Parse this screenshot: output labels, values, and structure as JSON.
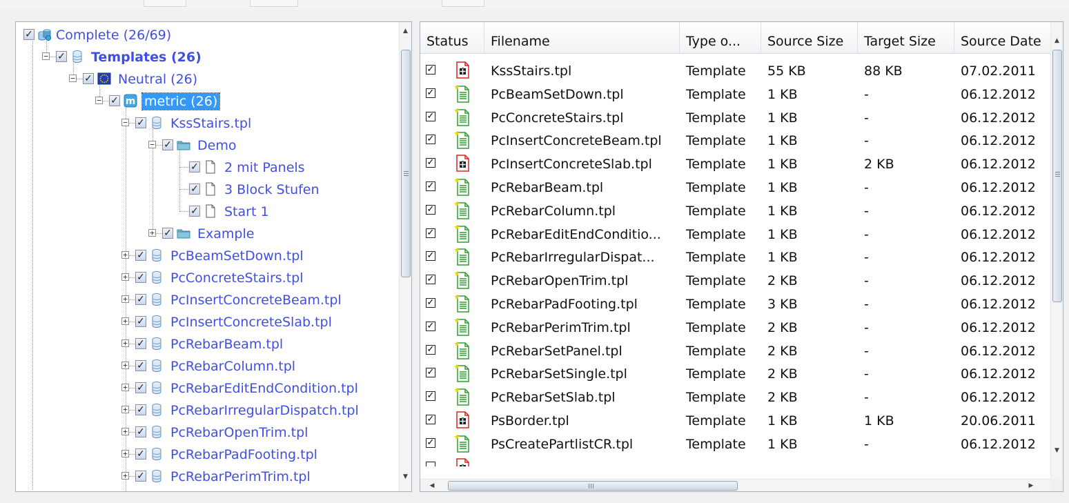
{
  "tree": {
    "items": [
      {
        "label": "Complete (26/69)",
        "level": 0,
        "expander": "none",
        "icon": "database-group-icon",
        "bold": false,
        "selected": false
      },
      {
        "label": "Templates (26)",
        "level": 1,
        "expander": "minus",
        "icon": "database-icon",
        "bold": true,
        "selected": false
      },
      {
        "label": "Neutral (26)",
        "level": 2,
        "expander": "minus",
        "icon": "eu-flag-icon",
        "bold": false,
        "selected": false
      },
      {
        "label": "metric (26)",
        "level": 3,
        "expander": "minus",
        "icon": "metric-m-icon",
        "bold": false,
        "selected": true
      },
      {
        "label": "KssStairs.tpl",
        "level": 4,
        "expander": "minus",
        "icon": "database-icon",
        "bold": false,
        "selected": false
      },
      {
        "label": "Demo",
        "level": 5,
        "expander": "minus",
        "icon": "folder-icon",
        "bold": false,
        "selected": false
      },
      {
        "label": "2 mit Panels",
        "level": 6,
        "expander": "none",
        "icon": "document-icon",
        "bold": false,
        "selected": false
      },
      {
        "label": "3 Block Stufen",
        "level": 6,
        "expander": "none",
        "icon": "document-icon",
        "bold": false,
        "selected": false
      },
      {
        "label": "Start 1",
        "level": 6,
        "expander": "none",
        "icon": "document-icon",
        "bold": false,
        "selected": false
      },
      {
        "label": "Example",
        "level": 5,
        "expander": "plus",
        "icon": "folder-icon",
        "bold": false,
        "selected": false
      },
      {
        "label": "PcBeamSetDown.tpl",
        "level": 4,
        "expander": "plus",
        "icon": "database-icon",
        "bold": false,
        "selected": false
      },
      {
        "label": "PcConcreteStairs.tpl",
        "level": 4,
        "expander": "plus",
        "icon": "database-icon",
        "bold": false,
        "selected": false
      },
      {
        "label": "PcInsertConcreteBeam.tpl",
        "level": 4,
        "expander": "plus",
        "icon": "database-icon",
        "bold": false,
        "selected": false
      },
      {
        "label": "PcInsertConcreteSlab.tpl",
        "level": 4,
        "expander": "plus",
        "icon": "database-icon",
        "bold": false,
        "selected": false
      },
      {
        "label": "PcRebarBeam.tpl",
        "level": 4,
        "expander": "plus",
        "icon": "database-icon",
        "bold": false,
        "selected": false
      },
      {
        "label": "PcRebarColumn.tpl",
        "level": 4,
        "expander": "plus",
        "icon": "database-icon",
        "bold": false,
        "selected": false
      },
      {
        "label": "PcRebarEditEndCondition.tpl",
        "level": 4,
        "expander": "plus",
        "icon": "database-icon",
        "bold": false,
        "selected": false
      },
      {
        "label": "PcRebarIrregularDispatch.tpl",
        "level": 4,
        "expander": "plus",
        "icon": "database-icon",
        "bold": false,
        "selected": false
      },
      {
        "label": "PcRebarOpenTrim.tpl",
        "level": 4,
        "expander": "plus",
        "icon": "database-icon",
        "bold": false,
        "selected": false
      },
      {
        "label": "PcRebarPadFooting.tpl",
        "level": 4,
        "expander": "plus",
        "icon": "database-icon",
        "bold": false,
        "selected": false
      },
      {
        "label": "PcRebarPerimTrim.tpl",
        "level": 4,
        "expander": "plus",
        "icon": "database-icon",
        "bold": false,
        "selected": false
      }
    ]
  },
  "list": {
    "columns": [
      "Status",
      "Filename",
      "Type o...",
      "Source Size",
      "Target Size",
      "Source Date"
    ],
    "rows": [
      {
        "status": "conflict",
        "filename": "KssStairs.tpl",
        "type": "Template",
        "source_size": "55 KB",
        "target_size": "88 KB",
        "source_date": "07.02.2011"
      },
      {
        "status": "new",
        "filename": "PcBeamSetDown.tpl",
        "type": "Template",
        "source_size": "1 KB",
        "target_size": "-",
        "source_date": "06.12.2012"
      },
      {
        "status": "new",
        "filename": "PcConcreteStairs.tpl",
        "type": "Template",
        "source_size": "1 KB",
        "target_size": "-",
        "source_date": "06.12.2012"
      },
      {
        "status": "new",
        "filename": "PcInsertConcreteBeam.tpl",
        "type": "Template",
        "source_size": "1 KB",
        "target_size": "-",
        "source_date": "06.12.2012"
      },
      {
        "status": "conflict",
        "filename": "PcInsertConcreteSlab.tpl",
        "type": "Template",
        "source_size": "1 KB",
        "target_size": "2 KB",
        "source_date": "06.12.2012"
      },
      {
        "status": "new",
        "filename": "PcRebarBeam.tpl",
        "type": "Template",
        "source_size": "1 KB",
        "target_size": "-",
        "source_date": "06.12.2012"
      },
      {
        "status": "new",
        "filename": "PcRebarColumn.tpl",
        "type": "Template",
        "source_size": "1 KB",
        "target_size": "-",
        "source_date": "06.12.2012"
      },
      {
        "status": "new",
        "filename": "PcRebarEditEndConditio...",
        "type": "Template",
        "source_size": "1 KB",
        "target_size": "-",
        "source_date": "06.12.2012"
      },
      {
        "status": "new",
        "filename": "PcRebarIrregularDispat...",
        "type": "Template",
        "source_size": "1 KB",
        "target_size": "-",
        "source_date": "06.12.2012"
      },
      {
        "status": "new",
        "filename": "PcRebarOpenTrim.tpl",
        "type": "Template",
        "source_size": "2 KB",
        "target_size": "-",
        "source_date": "06.12.2012"
      },
      {
        "status": "new",
        "filename": "PcRebarPadFooting.tpl",
        "type": "Template",
        "source_size": "3 KB",
        "target_size": "-",
        "source_date": "06.12.2012"
      },
      {
        "status": "new",
        "filename": "PcRebarPerimTrim.tpl",
        "type": "Template",
        "source_size": "2 KB",
        "target_size": "-",
        "source_date": "06.12.2012"
      },
      {
        "status": "new",
        "filename": "PcRebarSetPanel.tpl",
        "type": "Template",
        "source_size": "2 KB",
        "target_size": "-",
        "source_date": "06.12.2012"
      },
      {
        "status": "new",
        "filename": "PcRebarSetSingle.tpl",
        "type": "Template",
        "source_size": "2 KB",
        "target_size": "-",
        "source_date": "06.12.2012"
      },
      {
        "status": "new",
        "filename": "PcRebarSetSlab.tpl",
        "type": "Template",
        "source_size": "2 KB",
        "target_size": "-",
        "source_date": "06.12.2012"
      },
      {
        "status": "conflict",
        "filename": "PsBorder.tpl",
        "type": "Template",
        "source_size": "1 KB",
        "target_size": "1 KB",
        "source_date": "20.06.2011"
      },
      {
        "status": "new",
        "filename": "PsCreatePartlistCR.tpl",
        "type": "Template",
        "source_size": "1 KB",
        "target_size": "-",
        "source_date": "06.12.2012"
      }
    ]
  },
  "colors": {
    "tree_text": "#3f4fe6",
    "selection": "#3399ff",
    "conflict_icon": "#e02020",
    "new_icon": "#2aa02a"
  }
}
